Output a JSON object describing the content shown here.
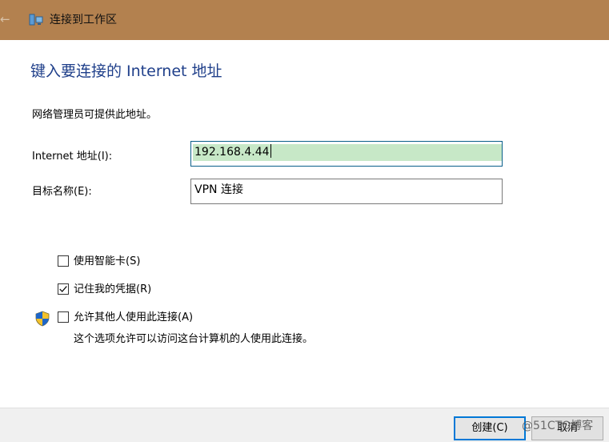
{
  "titlebar": {
    "title": "连接到工作区",
    "back_glyph": "←",
    "background": "#b3814f"
  },
  "icons": {
    "window": "network-icon",
    "allow": "shield-icon"
  },
  "heading": "键入要连接的 Internet 地址",
  "subtitle": "网络管理员可提供此地址。",
  "fields": {
    "address": {
      "label": "Internet 地址(I):",
      "value": "192.168.4.44"
    },
    "destination": {
      "label": "目标名称(E):",
      "value": "VPN 连接"
    }
  },
  "options": {
    "smart_card": {
      "label": "使用智能卡(S)",
      "checked": false
    },
    "remember": {
      "label": "记住我的凭据(R)",
      "checked": true
    },
    "allow_others": {
      "label": "允许其他人使用此连接(A)",
      "checked": false,
      "description": "这个选项允许可以访问这台计算机的人使用此连接。"
    }
  },
  "buttons": {
    "create": "创建(C)",
    "cancel": "取消"
  },
  "watermark": "@51CTO博客",
  "colors": {
    "heading": "#1f3f8a",
    "accent": "#0078d7",
    "selection": "#c7e8c7"
  }
}
